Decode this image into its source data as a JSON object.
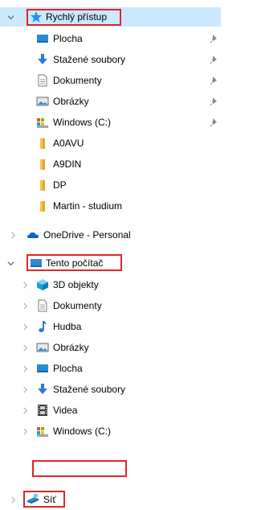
{
  "quick_access": {
    "title": "Rychlý přístup",
    "items": [
      {
        "label": "Plocha",
        "icon": "desktop-icon",
        "pinned": true
      },
      {
        "label": "Stažené soubory",
        "icon": "download-arrow-icon",
        "pinned": true
      },
      {
        "label": "Dokumenty",
        "icon": "document-icon",
        "pinned": true
      },
      {
        "label": "Obrázky",
        "icon": "pictures-icon",
        "pinned": true
      },
      {
        "label": "Windows (C:)",
        "icon": "drive-icon",
        "pinned": true
      },
      {
        "label": "A0AVU",
        "icon": "folder-icon",
        "pinned": false
      },
      {
        "label": "A9DIN",
        "icon": "folder-icon",
        "pinned": false
      },
      {
        "label": "DP",
        "icon": "folder-icon",
        "pinned": false
      },
      {
        "label": "Martin - studium",
        "icon": "folder-icon",
        "pinned": false
      }
    ]
  },
  "onedrive": {
    "label": "OneDrive - Personal",
    "icon": "cloud-icon"
  },
  "this_pc": {
    "title": "Tento počítač",
    "items": [
      {
        "label": "3D objekty",
        "icon": "cube-3d-icon"
      },
      {
        "label": "Dokumenty",
        "icon": "document-icon"
      },
      {
        "label": "Hudba",
        "icon": "music-note-icon"
      },
      {
        "label": "Obrázky",
        "icon": "pictures-icon"
      },
      {
        "label": "Plocha",
        "icon": "desktop-icon"
      },
      {
        "label": "Stažené soubory",
        "icon": "download-arrow-icon"
      },
      {
        "label": "Videa",
        "icon": "film-icon"
      },
      {
        "label": "Windows (C:)",
        "icon": "drive-icon"
      }
    ]
  },
  "network": {
    "label": "Síť",
    "icon": "network-icon"
  },
  "colors": {
    "selected": "#cce8ff",
    "highlight_box": "#e0262a",
    "star": "#1e90ff",
    "folder": "#f4c44e"
  }
}
